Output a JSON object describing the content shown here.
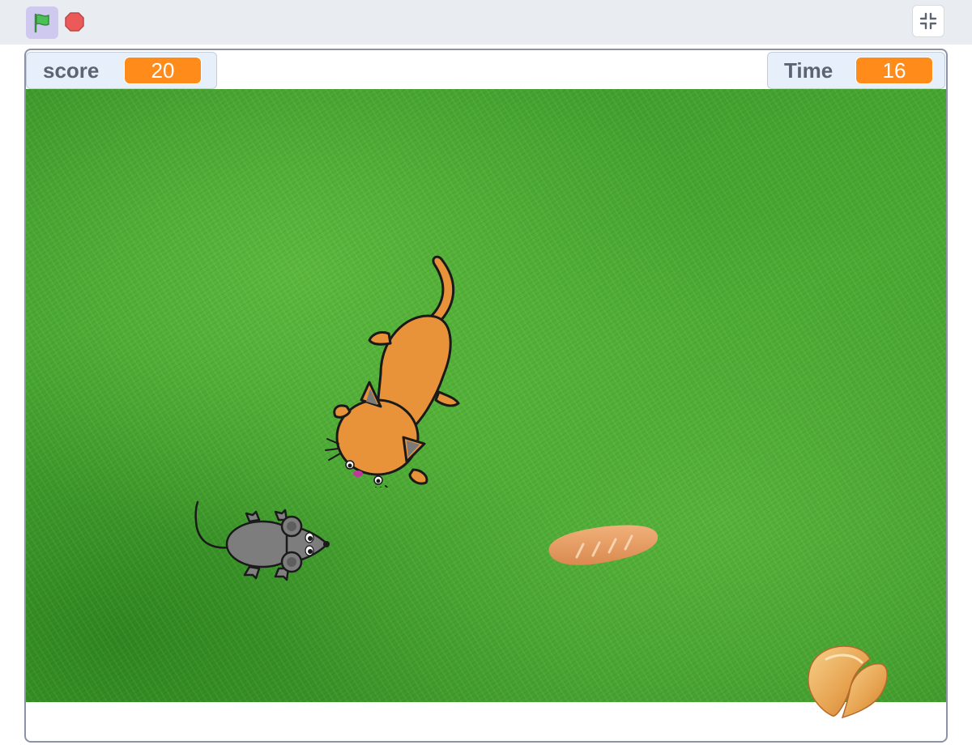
{
  "toolbar": {
    "green_flag_icon": "green-flag-icon",
    "stop_icon": "stop-sign-icon",
    "fullscreen_icon": "exit-fullscreen-icon",
    "flag_color": "#4cbf56",
    "stop_color": "#ec5959"
  },
  "monitors": {
    "score": {
      "label": "score",
      "value": "20"
    },
    "time": {
      "label": "Time",
      "value": "16"
    }
  },
  "stage": {
    "background": "grass",
    "sprites": [
      "cat",
      "mouse",
      "bread",
      "fortune-cookie"
    ]
  },
  "colors": {
    "monitor_value_bg": "#ff8c1a",
    "grass": "#3f9a2c"
  }
}
